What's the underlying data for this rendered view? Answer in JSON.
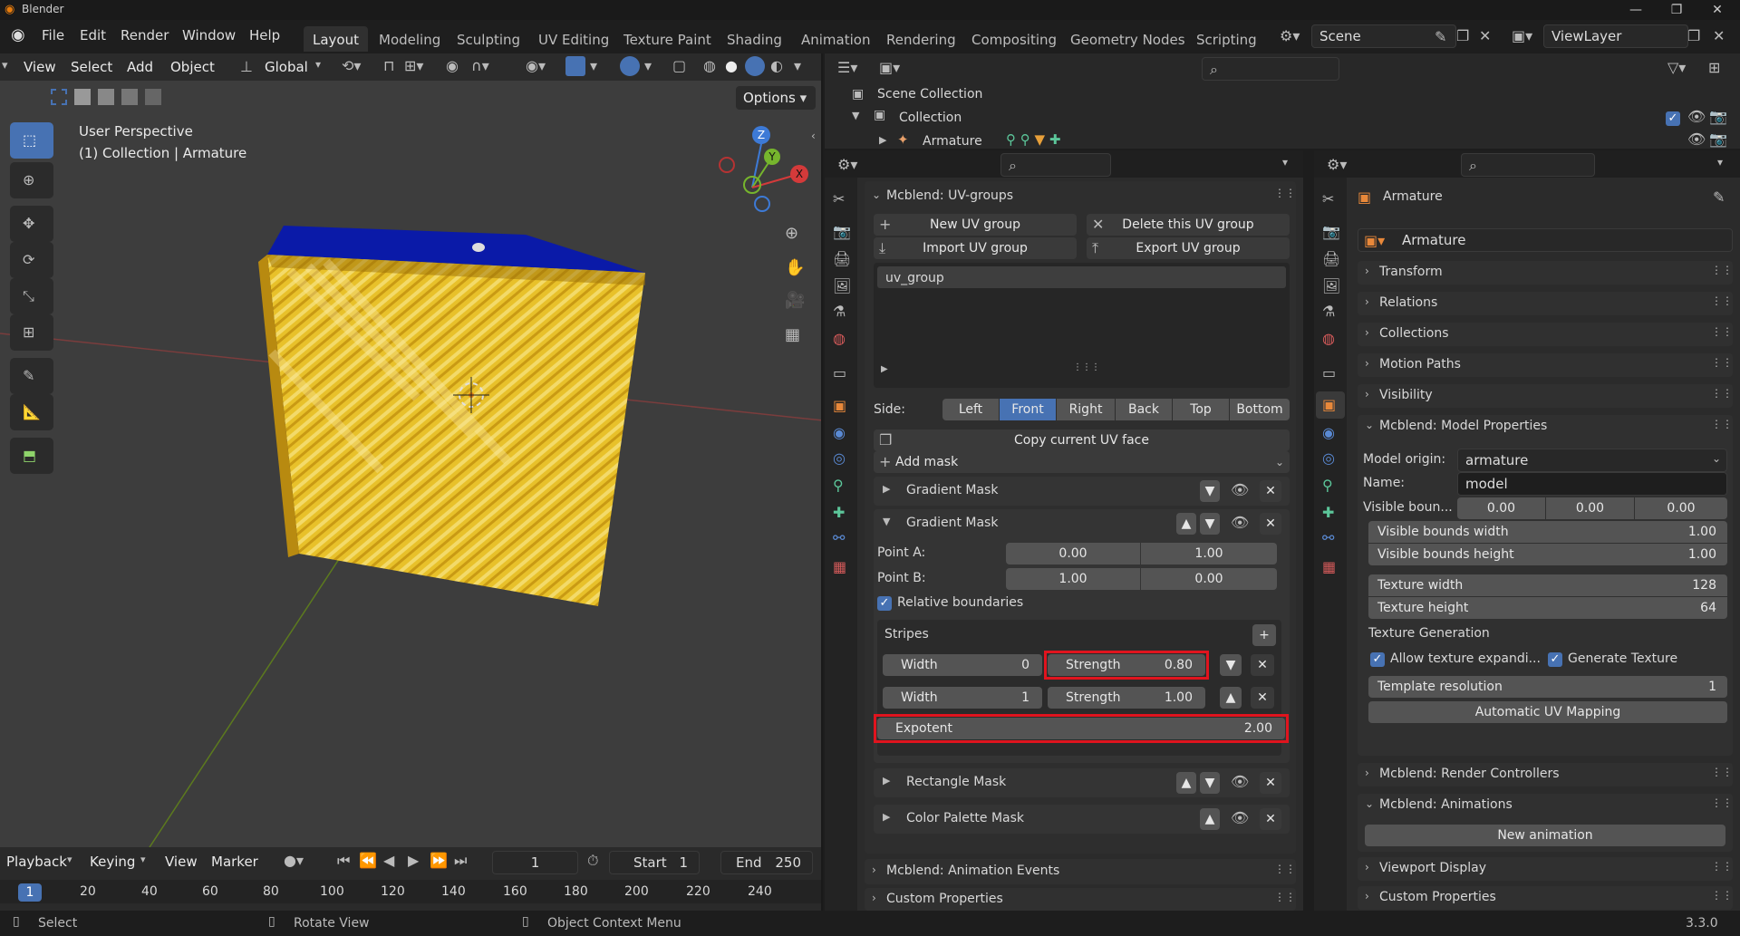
{
  "titlebar": {
    "title": "Blender"
  },
  "menu": {
    "file": "File",
    "edit": "Edit",
    "render": "Render",
    "window": "Window",
    "help": "Help"
  },
  "workspaces": [
    "Layout",
    "Modeling",
    "Sculpting",
    "UV Editing",
    "Texture Paint",
    "Shading",
    "Animation",
    "Rendering",
    "Compositing",
    "Geometry Nodes",
    "Scripting"
  ],
  "scene": {
    "name": "Scene",
    "view_layer": "ViewLayer"
  },
  "viewport": {
    "menus": [
      "View",
      "Select",
      "Add",
      "Object"
    ],
    "transform_orientation": "Global",
    "options_label": "Options",
    "perspective": "User Perspective",
    "context": "(1) Collection | Armature",
    "gizmo_axes": [
      "Z",
      "Y",
      "X"
    ]
  },
  "timeline": {
    "menus": [
      "Playback",
      "Keying",
      "View",
      "Marker"
    ],
    "current_frame": "1",
    "start_label": "Start",
    "start": "1",
    "end_label": "End",
    "end": "250",
    "ruler": [
      "1",
      "20",
      "40",
      "60",
      "80",
      "100",
      "120",
      "140",
      "160",
      "180",
      "200",
      "220",
      "240"
    ]
  },
  "status": {
    "select": "Select",
    "rotate": "Rotate View",
    "context_menu": "Object Context Menu",
    "version": "3.3.0"
  },
  "outliner": {
    "scene_collection": "Scene Collection",
    "collection": "Collection",
    "armature": "Armature"
  },
  "uvgroups": {
    "header": "Mcblend: UV-groups",
    "new": "New UV group",
    "delete": "Delete this UV group",
    "import": "Import UV group",
    "export": "Export UV group",
    "list_item": "uv_group",
    "side_label": "Side:",
    "sides": [
      "Left",
      "Front",
      "Right",
      "Back",
      "Top",
      "Bottom"
    ],
    "active_side": "Front",
    "copy_face": "Copy current UV face",
    "add_mask": "Add mask",
    "mask1": "Gradient Mask",
    "mask2": "Gradient Mask",
    "point_a_label": "Point A:",
    "point_a": [
      "0.00",
      "1.00"
    ],
    "point_b_label": "Point B:",
    "point_b": [
      "1.00",
      "0.00"
    ],
    "relative": "Relative boundaries",
    "stripes": "Stripes",
    "stripe1": {
      "width_label": "Width",
      "width": "0",
      "strength_label": "Strength",
      "strength": "0.80"
    },
    "stripe2": {
      "width_label": "Width",
      "width": "1",
      "strength_label": "Strength",
      "strength": "1.00"
    },
    "exponent_label": "Expotent",
    "exponent": "2.00",
    "mask3": "Rectangle Mask",
    "mask4": "Color Palette Mask",
    "anim_events": "Mcblend: Animation Events",
    "custom_props": "Custom Properties"
  },
  "object_props": {
    "object_name": "Armature",
    "data_name": "Armature",
    "sections": [
      "Transform",
      "Relations",
      "Collections",
      "Motion Paths",
      "Visibility"
    ],
    "model_props": "Mcblend: Model Properties",
    "origin_label": "Model origin:",
    "origin": "armature",
    "name_label": "Name:",
    "name": "model",
    "visible_bounds_label": "Visible boun...",
    "visible_bounds": [
      "0.00",
      "0.00",
      "0.00"
    ],
    "vb_width_label": "Visible bounds width",
    "vb_width": "1.00",
    "vb_height_label": "Visible bounds height",
    "vb_height": "1.00",
    "tex_width_label": "Texture width",
    "tex_width": "128",
    "tex_height_label": "Texture height",
    "tex_height": "64",
    "tex_gen": "Texture Generation",
    "allow_expand": "Allow texture expandi...",
    "gen_texture": "Generate Texture",
    "template_res_label": "Template resolution",
    "template_res": "1",
    "auto_uv": "Automatic UV Mapping",
    "render_controllers": "Mcblend: Render Controllers",
    "animations": "Mcblend: Animations",
    "new_animation": "New animation",
    "viewport_display": "Viewport Display",
    "custom_props": "Custom Properties"
  },
  "colors": {
    "accent": "#4772b3",
    "highlight": "#e0141e",
    "cube_face": "#e8c12a",
    "cube_top": "#0a1aa8"
  }
}
